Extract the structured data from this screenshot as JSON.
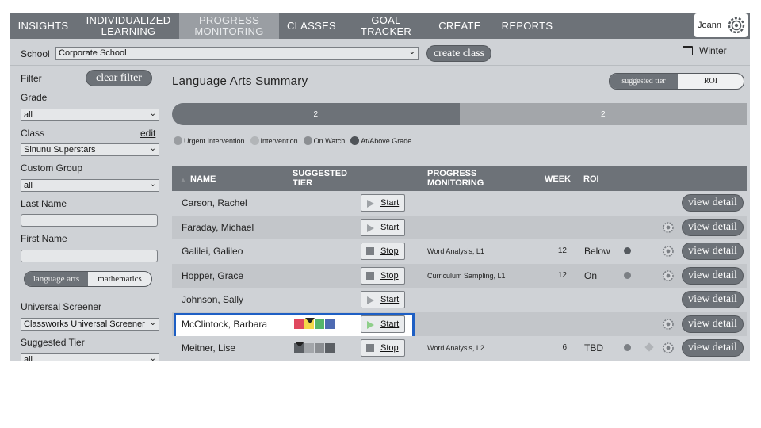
{
  "nav": {
    "items": [
      "INSIGHTS",
      "INDIVIDUALIZED LEARNING",
      "PROGRESS MONITORING",
      "CLASSES",
      "GOAL TRACKER",
      "CREATE",
      "REPORTS"
    ],
    "active": "PROGRESS MONITORING",
    "user": "Joann"
  },
  "schoolbar": {
    "label": "School",
    "school": "Corporate School",
    "create_class": "create class",
    "term": "Winter"
  },
  "sidebar": {
    "filter": "Filter",
    "clear_filter": "clear filter",
    "grade_label": "Grade",
    "grade_value": "all",
    "class_label": "Class",
    "edit": "edit",
    "class_value": "Sinunu Superstars",
    "custom_group_label": "Custom Group",
    "custom_group_value": "all",
    "last_name_label": "Last Name",
    "first_name_label": "First Name",
    "subject_options": [
      "language arts",
      "mathematics"
    ],
    "universal_screener_label": "Universal Screener",
    "universal_screener_value": "Classworks Universal Screener",
    "suggested_tier_label": "Suggested Tier",
    "suggested_tier_value": "all"
  },
  "main": {
    "title": "Language Arts Summary",
    "view_toggle": [
      "suggested tier",
      "ROI"
    ],
    "progress": {
      "segments": [
        {
          "value": "2",
          "fraction": 0.5,
          "color": "#6d7278"
        },
        {
          "value": "2",
          "fraction": 0.5,
          "color": "#a3a6aa"
        }
      ]
    },
    "legend": [
      {
        "label": "Urgent Intervention",
        "color": "#9a9da1"
      },
      {
        "label": "Intervention",
        "color": "#b2b5b8"
      },
      {
        "label": "On Watch",
        "color": "#8b8e92"
      },
      {
        "label": "At/Above Grade",
        "color": "#4f5358"
      }
    ],
    "columns": {
      "name": "NAME",
      "tier": "SUGGESTED TIER",
      "pm": "PROGRESS MONITORING",
      "week": "WEEK",
      "roi": "ROI"
    },
    "rows": [
      {
        "name": "Carson, Rachel",
        "action": "Start",
        "pm": "",
        "week": "",
        "roi": "",
        "tier": null,
        "gear": false
      },
      {
        "name": "Faraday, Michael",
        "action": "Start",
        "pm": "",
        "week": "",
        "roi": "",
        "tier": null,
        "gear": true
      },
      {
        "name": "Galilei, Galileo",
        "action": "Stop",
        "pm": "Word Analysis, L1",
        "week": "12",
        "roi": "Below",
        "tier": null,
        "gear": true,
        "dot_color": "#555a5f"
      },
      {
        "name": "Hopper, Grace",
        "action": "Stop",
        "pm": "Curriculum Sampling, L1",
        "week": "12",
        "roi": "On",
        "tier": null,
        "gear": true,
        "dot_color": "#7b7f84"
      },
      {
        "name": "Johnson, Sally",
        "action": "Start",
        "pm": "",
        "week": "",
        "roi": "",
        "tier": null,
        "gear": false
      },
      {
        "name": "McClintock, Barbara",
        "action": "Start",
        "pm": "",
        "week": "",
        "roi": "",
        "tier": {
          "colors": [
            "#e0485e",
            "#f3d74a",
            "#55b56b",
            "#4e6ab2"
          ],
          "marker": 1
        },
        "gear": true,
        "highlight": true
      },
      {
        "name": "Meitner, Lise",
        "action": "Stop",
        "pm": "Word Analysis, L2",
        "week": "6",
        "roi": "TBD",
        "tier": {
          "colors": [
            "#5b5f64",
            "#a3a6aa",
            "#8b8e92",
            "#5b5f64"
          ],
          "marker": 0
        },
        "gear": true,
        "dot_color": "#7b7f84",
        "diamond": true
      }
    ],
    "view_detail": "view detail"
  }
}
